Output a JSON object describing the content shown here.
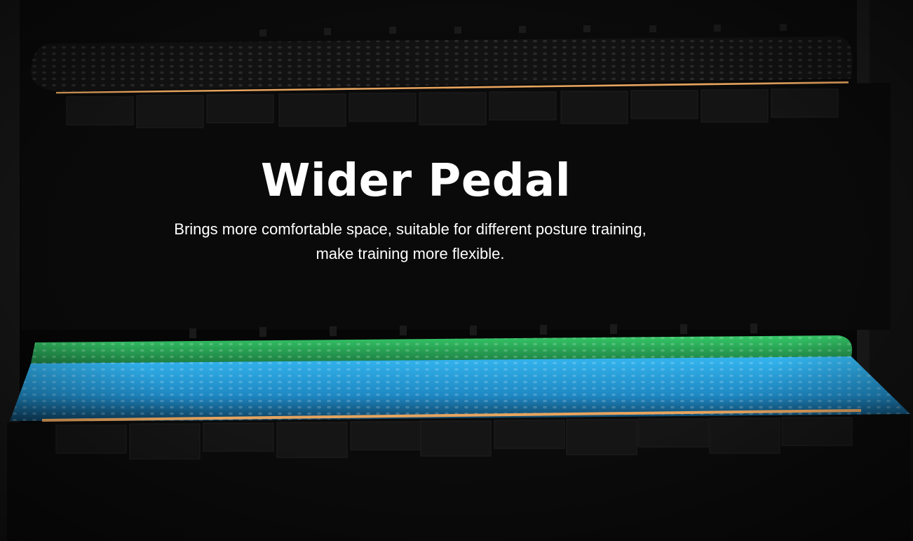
{
  "headline": "Wider Pedal",
  "description": {
    "line1": "Brings more comfortable space, suitable for different posture training,",
    "line2": "make training more flexible."
  },
  "colors": {
    "background": "#060606",
    "text": "#ffffff",
    "accent_orange": "#e7a45e",
    "highlight_green": "#2fbd63",
    "highlight_blue": "#2aa7e4"
  }
}
